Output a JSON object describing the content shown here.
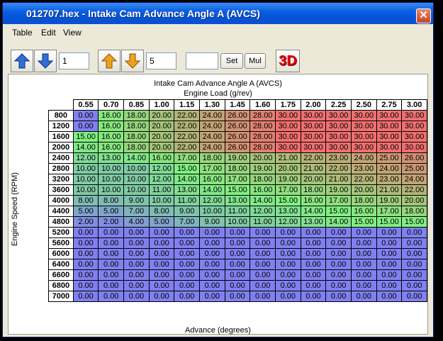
{
  "window": {
    "title": "012707.hex - Intake Cam Advance Angle A (AVCS)",
    "close_glyph": "✕"
  },
  "menu": [
    "Table",
    "Edit",
    "View"
  ],
  "toolbar": {
    "step_value": "1",
    "inc_value": "5",
    "set_value": "",
    "set_label": "Set",
    "mul_label": "Mul",
    "three_d_label": "3D",
    "colors": {
      "blue_arrow": "#2f6fd6",
      "orange_arrow": "#f0a020"
    }
  },
  "map": {
    "title": "Intake Cam Advance Angle A (AVCS)",
    "x_axis_label": "Engine Load (g/rev)",
    "y_axis_label": "Engine Speed (RPM)",
    "z_label": "Advance (degrees)",
    "columns": [
      "0.55",
      "0.70",
      "0.85",
      "1.00",
      "1.15",
      "1.30",
      "1.45",
      "1.60",
      "1.75",
      "2.00",
      "2.25",
      "2.50",
      "2.75",
      "3.00"
    ],
    "rows": [
      "800",
      "1200",
      "1600",
      "2000",
      "2400",
      "2800",
      "3200",
      "3600",
      "4000",
      "4400",
      "4800",
      "5200",
      "5600",
      "6000",
      "6400",
      "6600",
      "6800",
      "7000"
    ],
    "values": [
      [
        "0.00",
        "16.00",
        "18.00",
        "20.00",
        "22.00",
        "24.00",
        "26.00",
        "28.00",
        "30.00",
        "30.00",
        "30.00",
        "30.00",
        "30.00",
        "30.00"
      ],
      [
        "0.00",
        "16.00",
        "18.00",
        "20.00",
        "22.00",
        "24.00",
        "26.00",
        "28.00",
        "30.00",
        "30.00",
        "30.00",
        "30.00",
        "30.00",
        "30.00"
      ],
      [
        "15.00",
        "16.00",
        "18.00",
        "20.00",
        "22.00",
        "24.00",
        "26.00",
        "28.00",
        "30.00",
        "30.00",
        "30.00",
        "30.00",
        "30.00",
        "30.00"
      ],
      [
        "14.00",
        "16.00",
        "18.00",
        "20.00",
        "22.00",
        "24.00",
        "26.00",
        "28.00",
        "30.00",
        "30.00",
        "30.00",
        "30.00",
        "30.00",
        "30.00"
      ],
      [
        "12.00",
        "13.00",
        "14.00",
        "16.00",
        "17.00",
        "18.00",
        "19.00",
        "20.00",
        "21.00",
        "22.00",
        "23.00",
        "24.00",
        "25.00",
        "26.00"
      ],
      [
        "10.00",
        "10.00",
        "10.00",
        "12.00",
        "15.00",
        "17.00",
        "18.00",
        "19.00",
        "20.00",
        "21.00",
        "22.00",
        "23.00",
        "24.00",
        "25.00"
      ],
      [
        "10.00",
        "10.00",
        "10.00",
        "12.00",
        "14.00",
        "16.00",
        "17.00",
        "18.00",
        "19.00",
        "20.00",
        "21.00",
        "22.00",
        "23.00",
        "24.00"
      ],
      [
        "10.00",
        "10.00",
        "10.00",
        "11.00",
        "13.00",
        "14.00",
        "15.00",
        "16.00",
        "17.00",
        "18.00",
        "19.00",
        "20.00",
        "21.00",
        "22.00"
      ],
      [
        "8.00",
        "8.00",
        "9.00",
        "10.00",
        "11.00",
        "12.00",
        "13.00",
        "14.00",
        "15.00",
        "16.00",
        "17.00",
        "18.00",
        "19.00",
        "20.00"
      ],
      [
        "5.00",
        "5.00",
        "7.00",
        "8.00",
        "9.00",
        "10.00",
        "11.00",
        "12.00",
        "13.00",
        "14.00",
        "15.00",
        "16.00",
        "17.00",
        "18.00"
      ],
      [
        "2.00",
        "2.00",
        "4.00",
        "5.00",
        "7.00",
        "9.00",
        "10.00",
        "11.00",
        "12.00",
        "13.00",
        "14.00",
        "15.00",
        "15.00",
        "15.00"
      ],
      [
        "0.00",
        "0.00",
        "0.00",
        "0.00",
        "0.00",
        "0.00",
        "0.00",
        "0.00",
        "0.00",
        "0.00",
        "0.00",
        "0.00",
        "0.00",
        "0.00"
      ],
      [
        "0.00",
        "0.00",
        "0.00",
        "0.00",
        "0.00",
        "0.00",
        "0.00",
        "0.00",
        "0.00",
        "0.00",
        "0.00",
        "0.00",
        "0.00",
        "0.00"
      ],
      [
        "0.00",
        "0.00",
        "0.00",
        "0.00",
        "0.00",
        "0.00",
        "0.00",
        "0.00",
        "0.00",
        "0.00",
        "0.00",
        "0.00",
        "0.00",
        "0.00"
      ],
      [
        "0.00",
        "0.00",
        "0.00",
        "0.00",
        "0.00",
        "0.00",
        "0.00",
        "0.00",
        "0.00",
        "0.00",
        "0.00",
        "0.00",
        "0.00",
        "0.00"
      ],
      [
        "0.00",
        "0.00",
        "0.00",
        "0.00",
        "0.00",
        "0.00",
        "0.00",
        "0.00",
        "0.00",
        "0.00",
        "0.00",
        "0.00",
        "0.00",
        "0.00"
      ],
      [
        "0.00",
        "0.00",
        "0.00",
        "0.00",
        "0.00",
        "0.00",
        "0.00",
        "0.00",
        "0.00",
        "0.00",
        "0.00",
        "0.00",
        "0.00",
        "0.00"
      ],
      [
        "0.00",
        "0.00",
        "0.00",
        "0.00",
        "0.00",
        "0.00",
        "0.00",
        "0.00",
        "0.00",
        "0.00",
        "0.00",
        "0.00",
        "0.00",
        "0.00"
      ]
    ],
    "color_scale": {
      "min": 0,
      "max": 30,
      "low": "#8080f0",
      "mid": "#80f080",
      "high": "#f07070"
    }
  }
}
